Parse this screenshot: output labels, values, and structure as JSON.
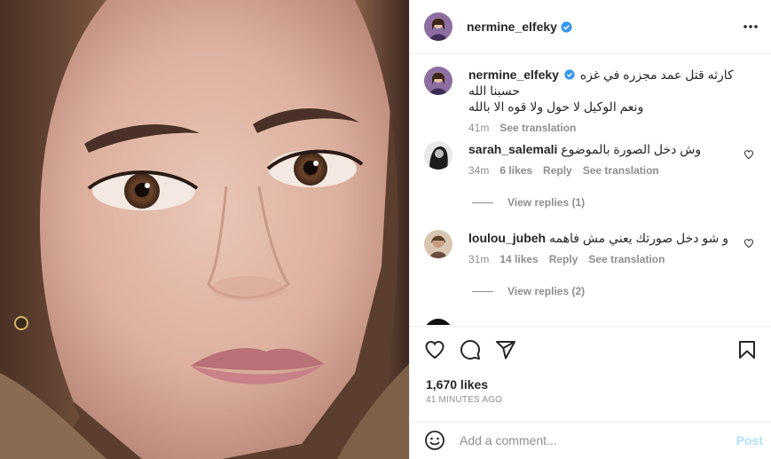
{
  "post": {
    "author": "nermine_elfeky",
    "caption_author": "nermine_elfeky",
    "caption_line1": "كارثه قتل عمد مجزره في غزه حسبنا الله",
    "caption_line2": "ونعم الوكيل لا حول ولا قوه الا بالله",
    "caption_time": "41m",
    "caption_translate": "See translation"
  },
  "comments": [
    {
      "user": "sarah_salemali",
      "text": "وش دخل الصورة بالموضوع",
      "time": "34m",
      "likes": "6 likes",
      "reply": "Reply",
      "translate": "See translation",
      "view_replies": "View replies (1)"
    },
    {
      "user": "loulou_jubeh",
      "text": "و شو دخل صورتك يعني مش فاهمه",
      "time": "31m",
      "likes": "14 likes",
      "reply": "Reply",
      "translate": "See translation",
      "view_replies": "View replies (2)"
    }
  ],
  "footer": {
    "likes": "1,670 likes",
    "timestamp": "41 MINUTES AGO",
    "comment_placeholder": "Add a comment...",
    "post_label": "Post"
  },
  "icons": {
    "more": "more-options-icon",
    "verified": "verified-badge-icon",
    "like": "heart-icon",
    "comment": "comment-icon",
    "share": "send-icon",
    "save": "bookmark-icon",
    "emoji": "emoji-icon"
  },
  "colors": {
    "verified": "#3897f0",
    "muted": "#8e8e8e",
    "post_disabled": "#b2dffc"
  }
}
